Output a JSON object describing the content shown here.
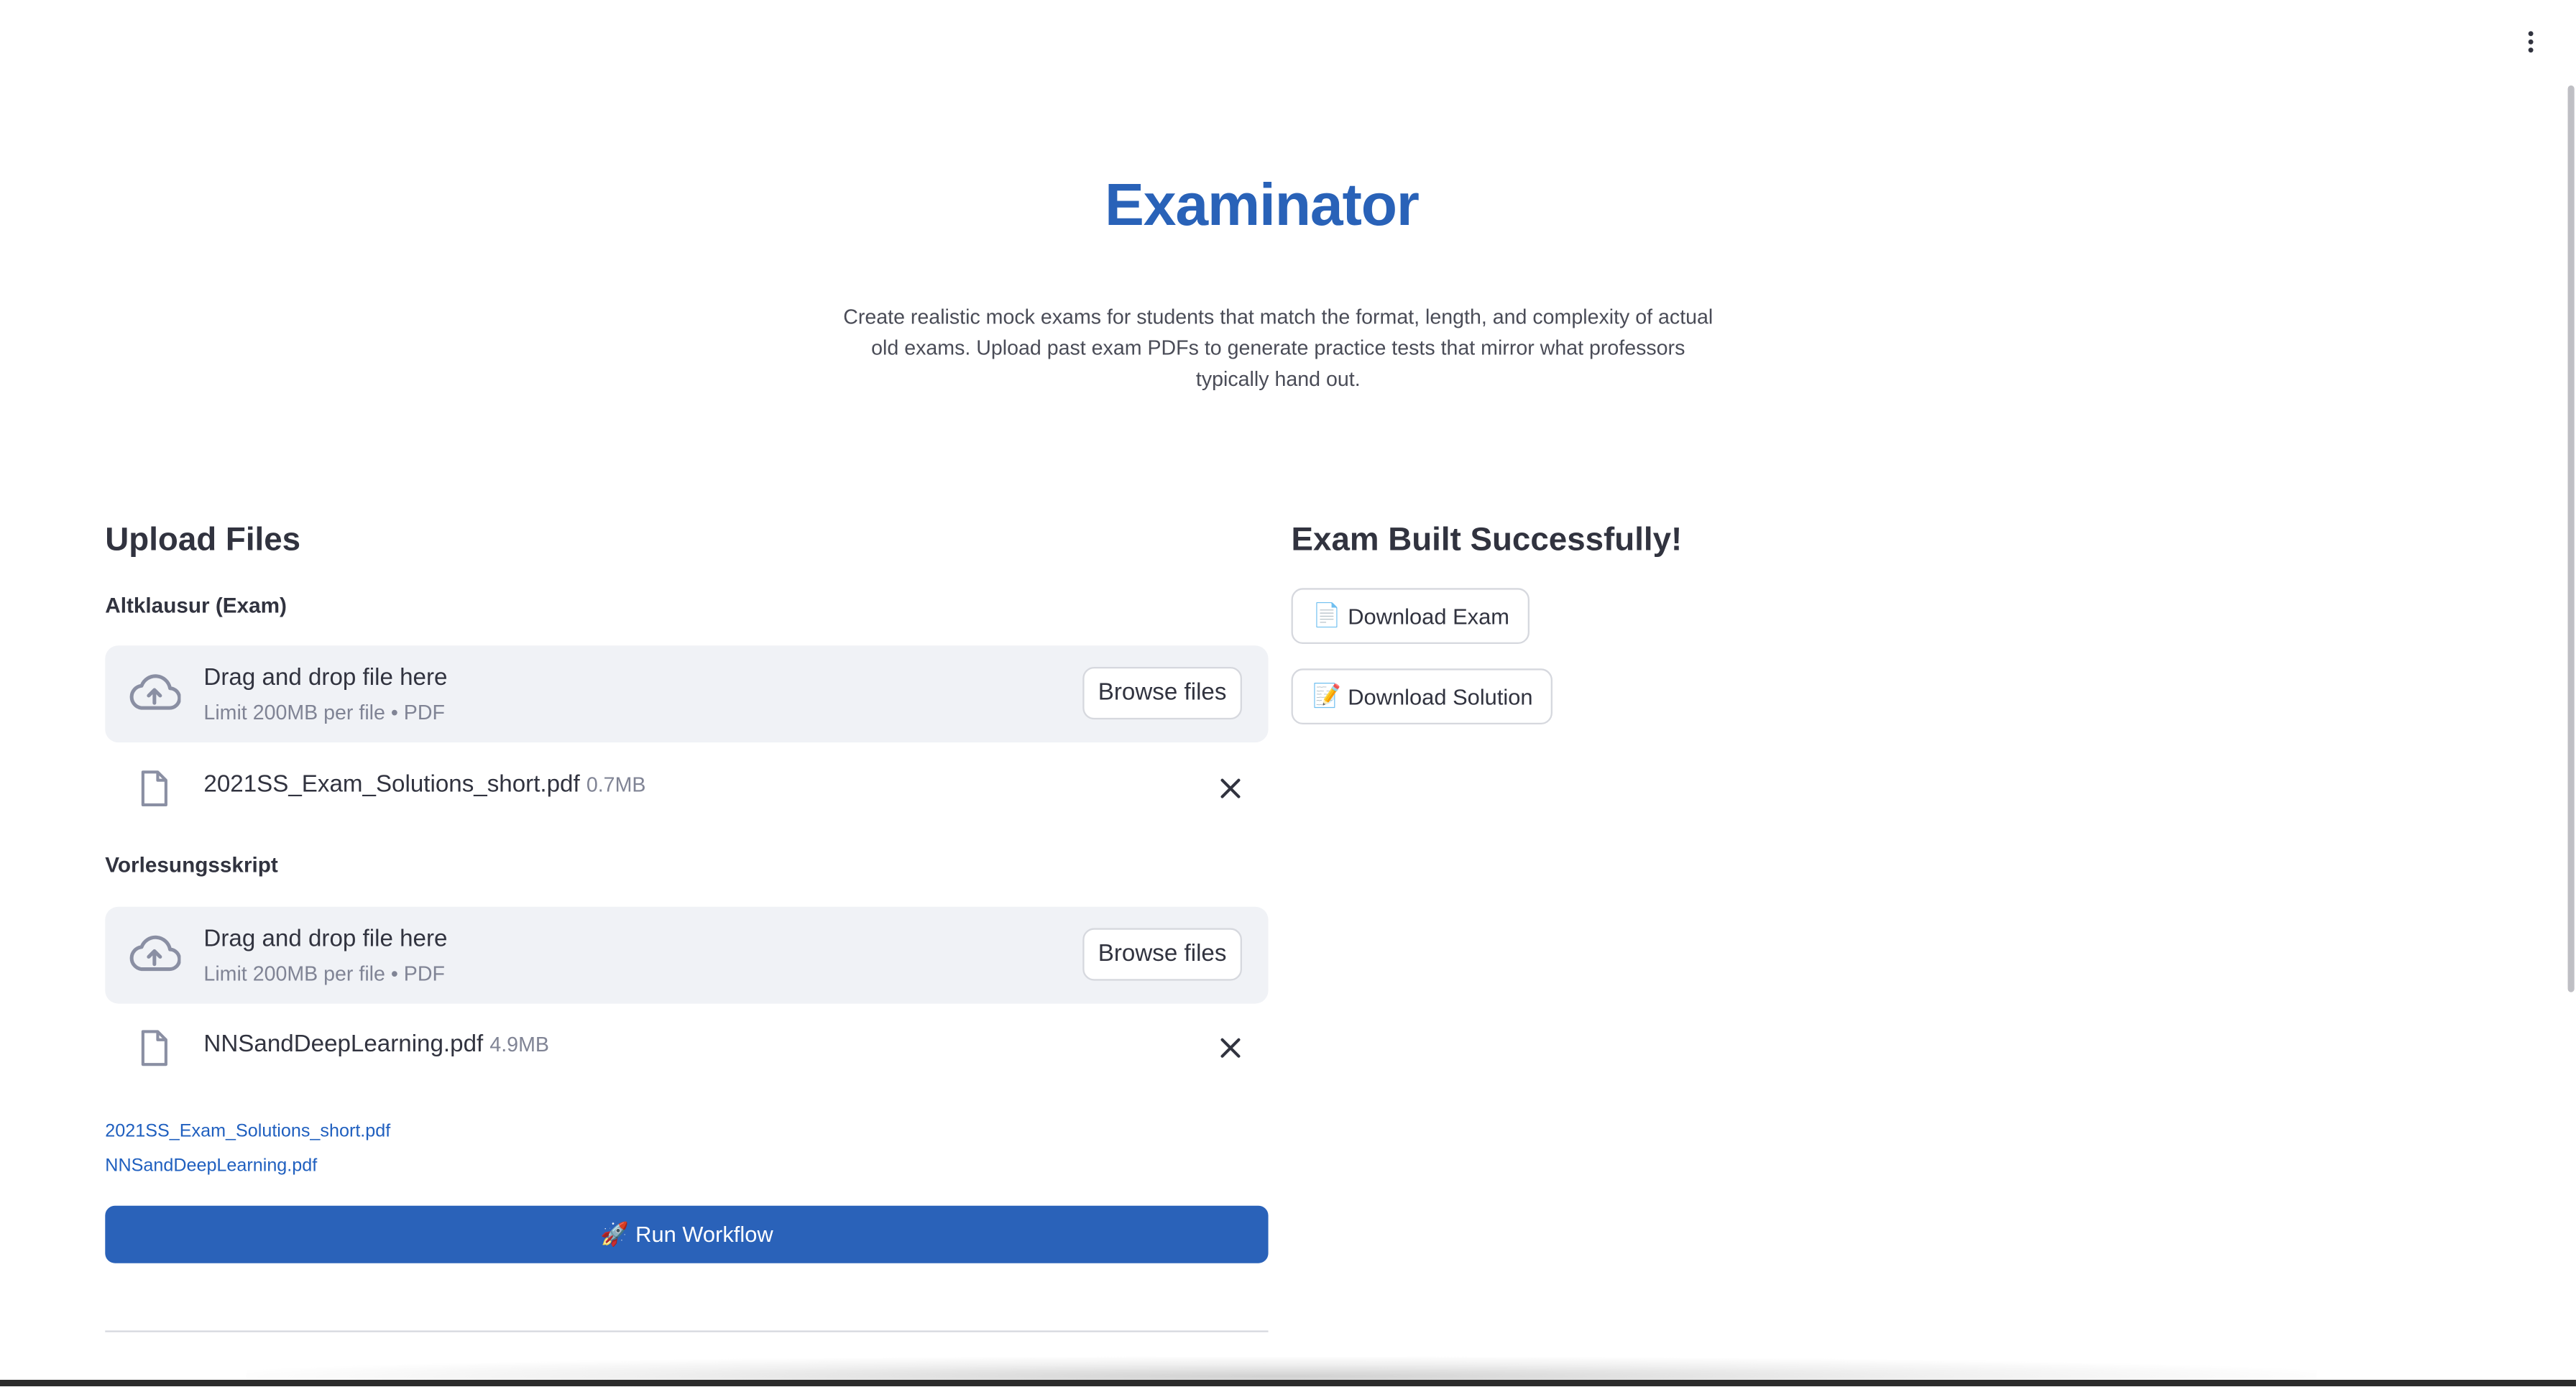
{
  "header": {
    "title": "Examinator",
    "subtitle": "Create realistic mock exams for students that match the format, length, and complexity of actual old exams. Upload past exam PDFs to generate practice tests that mirror what professors typically hand out."
  },
  "upload": {
    "heading": "Upload Files",
    "exam": {
      "label": "Altklausur (Exam)",
      "dropzone_title": "Drag and drop file here",
      "dropzone_limit": "Limit 200MB per file • PDF",
      "browse_label": "Browse files",
      "file_name": "2021SS_Exam_Solutions_short.pdf",
      "file_size": "0.7MB"
    },
    "script": {
      "label": "Vorlesungsskript",
      "dropzone_title": "Drag and drop file here",
      "dropzone_limit": "Limit 200MB per file • PDF",
      "browse_label": "Browse files",
      "file_name": "NNSandDeepLearning.pdf",
      "file_size": "4.9MB"
    },
    "links": [
      "2021SS_Exam_Solutions_short.pdf",
      "NNSandDeepLearning.pdf"
    ],
    "run_label": "Run Workflow",
    "run_emoji": "🚀"
  },
  "result": {
    "heading": "Exam Built Successfully!",
    "download_exam_label": "Download Exam",
    "download_exam_emoji": "📄",
    "download_solution_label": "Download Solution",
    "download_solution_emoji": "📝"
  },
  "colors": {
    "accent": "#2a62b9",
    "title": "#2962b8",
    "dropzone_bg": "#f0f2f6",
    "muted_text": "#808495"
  }
}
